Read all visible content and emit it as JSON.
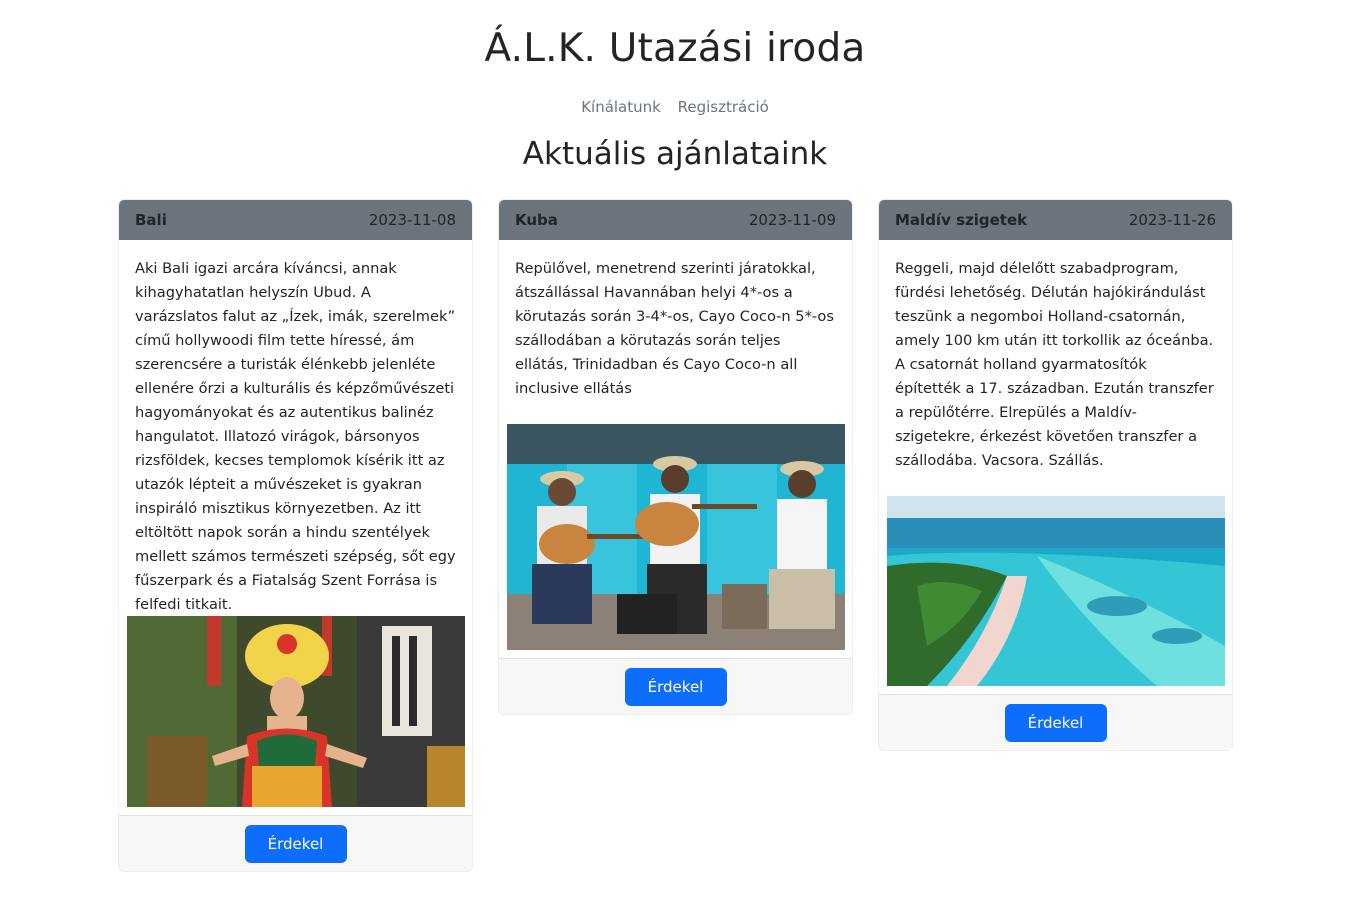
{
  "header": {
    "title": "Á.L.K. Utazási iroda",
    "nav": [
      "Kínálatunk",
      "Regisztráció"
    ]
  },
  "section_title": "Aktuális ajánlataink",
  "colors": {
    "card_header": "#6c757d",
    "button": "#0d6efd",
    "footer": "#f7f7f7"
  },
  "cards": [
    {
      "name": "Bali",
      "date": "2023-11-08",
      "text": "Aki Bali igazi arcára kíváncsi, annak kihagyhatatlan helyszín Ubud. A varázslatos falut az „Ízek, imák, szerelmek” című hollywoodi film tette híressé, ám szerencsére a turisták élénkebb jelenléte ellenére őrzi a kulturális és képzőművészeti hagyományokat és az autentikus balinéz hangulatot. Illatozó virágok, bársonyos rizsföldek, kecses templomok kísérik itt az utazók lépteit a művészeket is gyakran inspiráló misztikus környezetben. Az itt eltöltött napok során a hindu szentélyek mellett számos természeti szépség, sőt egy fűszerpark és a Fiatalság Szent Forrása is felfedi titkait.",
      "button": "Érdekel"
    },
    {
      "name": "Kuba",
      "date": "2023-11-09",
      "text": "Repülővel, menetrend szerinti járatokkal, átszállással Havannában helyi 4*-os a körutazás során 3-4*-os, Cayo Coco-n 5*-os szállodában a körutazás során teljes ellátás, Trinidadban és Cayo Coco-n all inclusive ellátás",
      "button": "Érdekel"
    },
    {
      "name": "Maldív szigetek",
      "date": "2023-11-26",
      "text": "Reggeli, majd délelőtt szabadprogram, fürdési lehetőség. Délután hajókirándulást teszünk a negomboi Holland-csatornán, amely 100 km után itt torkollik az óceánba. A csatornát holland gyarmatosítók építették a 17. században. Ezután transzfer a repülőtérre. Elrepülés a Maldív-szigetekre, érkezést követően transzfer a szállodába. Vacsora. Szállás.",
      "button": "Érdekel"
    }
  ]
}
